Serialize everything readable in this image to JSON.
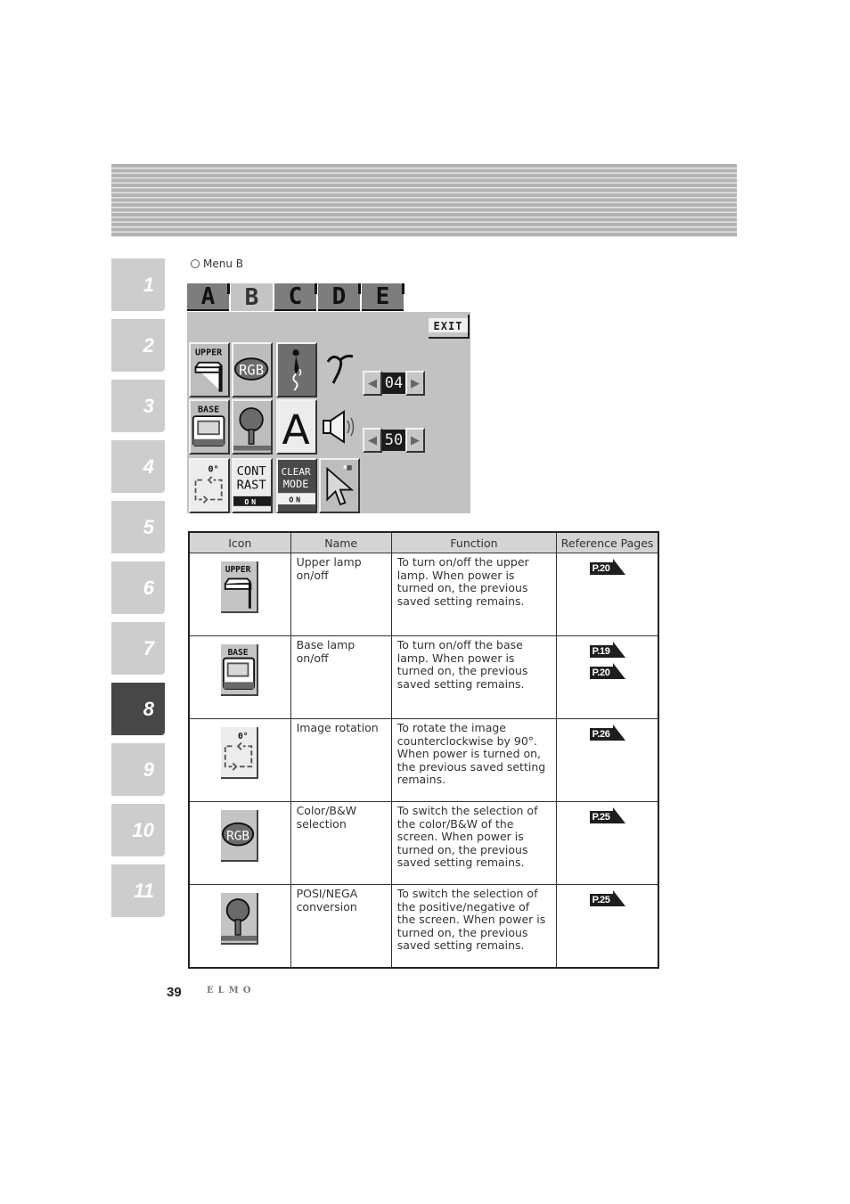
{
  "chapters": [
    {
      "label": "1",
      "active": false
    },
    {
      "label": "2",
      "active": false
    },
    {
      "label": "3",
      "active": false
    },
    {
      "label": "4",
      "active": false
    },
    {
      "label": "5",
      "active": false
    },
    {
      "label": "6",
      "active": false
    },
    {
      "label": "7",
      "active": false
    },
    {
      "label": "8",
      "active": true
    },
    {
      "label": "9",
      "active": false
    },
    {
      "label": "10",
      "active": false
    },
    {
      "label": "11",
      "active": false
    }
  ],
  "section": {
    "label": "Menu B"
  },
  "osd": {
    "tabs": [
      {
        "label": "A",
        "selected": false
      },
      {
        "label": "B",
        "selected": true
      },
      {
        "label": "C",
        "selected": false
      },
      {
        "label": "D",
        "selected": false
      },
      {
        "label": "E",
        "selected": false
      }
    ],
    "exit_label": "EXIT",
    "icons": {
      "upper": "UPPER",
      "rgb": "RGB",
      "base": "BASE",
      "a_letter": "A",
      "rotation": "0°",
      "contrast_line1": "CONT",
      "contrast_line2": "RAST",
      "contrast_state": "ON",
      "clear_line1": "CLEAR",
      "clear_line2": "MODE",
      "clear_state": "ON"
    },
    "gamma_value": "04",
    "volume_value": "50"
  },
  "table": {
    "headers": {
      "icon": "Icon",
      "name": "Name",
      "function": "Function",
      "ref": "Reference Pages"
    },
    "rows": [
      {
        "icon": "upper-lamp",
        "name": "Upper lamp on/off",
        "function": "To turn on/off the upper lamp. When power is turned on, the previous saved setting remains.",
        "refs": [
          "P.20"
        ]
      },
      {
        "icon": "base-lamp",
        "name": "Base lamp on/off",
        "function": "To turn on/off the base lamp. When power is turned on, the previous saved setting remains.",
        "refs": [
          "P.19",
          "P.20"
        ]
      },
      {
        "icon": "image-rotation",
        "name": "Image rotation",
        "function": "To rotate the image counterclockwise by 90°. When power is turned on, the previous saved setting remains.",
        "refs": [
          "P.26"
        ]
      },
      {
        "icon": "color-bw",
        "name": "Color/B&W selection",
        "function": "To switch the selection of the color/B&W of the screen. When power is turned on, the previous saved setting remains.",
        "refs": [
          "P.25"
        ]
      },
      {
        "icon": "posi-nega",
        "name": "POSI/NEGA conversion",
        "function": "To switch the selection of the positive/negative of the screen. When power is turned on, the previous saved setting remains.",
        "refs": [
          "P.25"
        ]
      }
    ]
  },
  "footer": {
    "page_number": "39",
    "brand": "ELMO"
  }
}
